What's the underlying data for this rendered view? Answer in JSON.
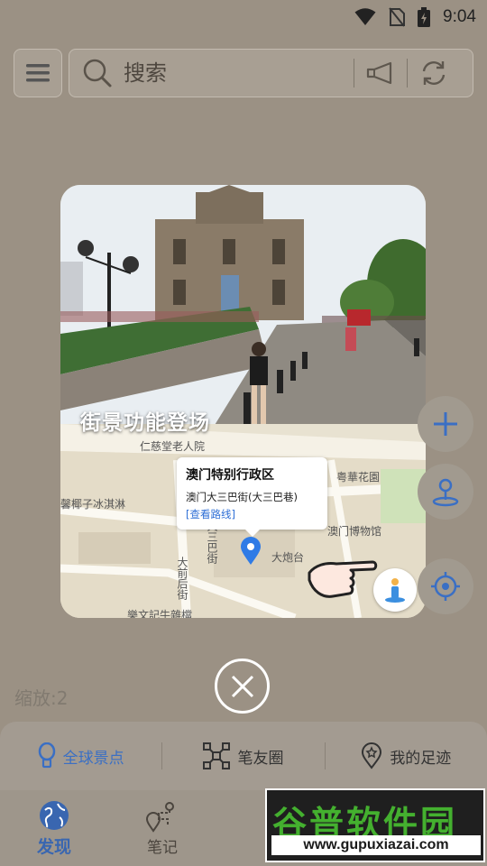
{
  "status": {
    "time": "9:04"
  },
  "search": {
    "placeholder": "搜索"
  },
  "promo": {
    "title": "街景功能登场",
    "map_labels": {
      "ren_ci_tang": "仁慈堂老人院",
      "coconut": "馨椰子冰淇淋",
      "garden": "粤華花園",
      "museum": "澳门博物馆",
      "fortress": "大炮台",
      "street_v1": "大三巴街",
      "street_v2": "大前后街",
      "bottom": "樂文記牛雜檔"
    },
    "info": {
      "title": "澳门特别行政区",
      "address": "澳门大三巴街(大三巴巷)",
      "link": "[查看路线]"
    }
  },
  "zoom": "缩放:2",
  "categories": [
    {
      "label": "全球景点",
      "icon": "bulb-icon"
    },
    {
      "label": "笔友圈",
      "icon": "network-icon"
    },
    {
      "label": "我的足迹",
      "icon": "footprint-icon"
    }
  ],
  "tabs": [
    {
      "label": "发现",
      "icon": "globe-icon"
    },
    {
      "label": "笔记",
      "icon": "route-icon"
    }
  ],
  "watermark": {
    "name": "谷普软件园",
    "url": "www.gupuxiazai.com"
  },
  "colors": {
    "accent": "#3a6fc4",
    "overlay_bg": "#9b9184",
    "pin": "#2f7be6"
  }
}
